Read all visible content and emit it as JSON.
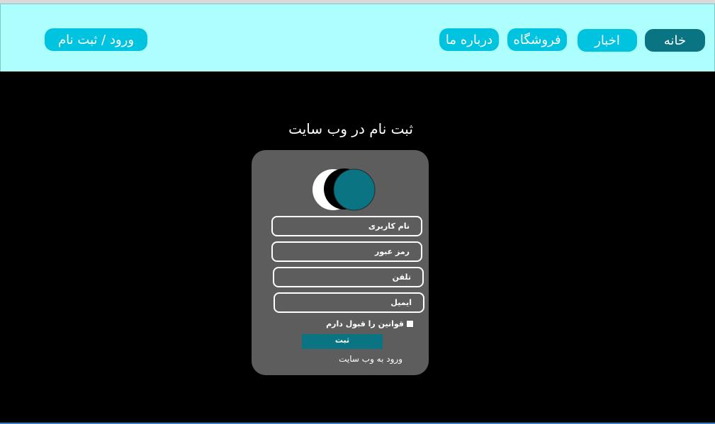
{
  "nav": {
    "home": "خانه",
    "news": "اخبار",
    "shop": "فروشگاه",
    "about": "درباره ما",
    "auth": "ورود /  ثبت  نام"
  },
  "page": {
    "title": "ثبت نام در وب سایت"
  },
  "form": {
    "username_placeholder": "نام کاربری",
    "password_placeholder": "رمز عبور",
    "phone_placeholder": "تلفن",
    "email_placeholder": "ایمیل",
    "terms_label": "قوانین را قبول دارم",
    "submit_label": "ثبت",
    "login_link": "ورود به وب سایت"
  },
  "colors": {
    "header_bg": "#adfffd",
    "nav_active": "#0b7482",
    "nav_default": "#00c3e0",
    "card_bg": "#5d5d5d",
    "accent": "#0b7482"
  },
  "icons": {
    "logo": "overlapping-circles-icon"
  }
}
